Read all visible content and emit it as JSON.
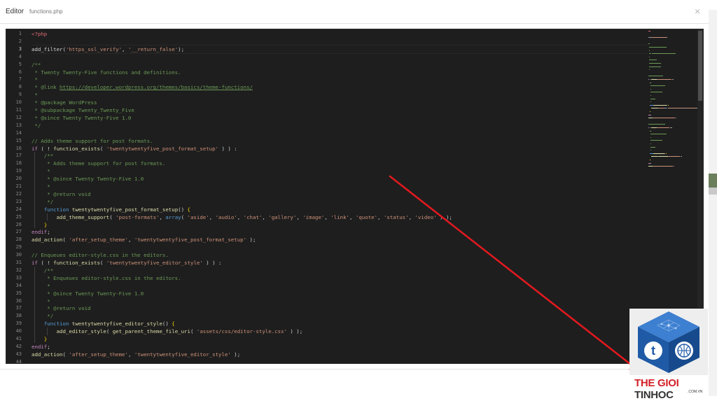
{
  "modal": {
    "title": "Editor",
    "subtitle": "functions.php",
    "close_symbol": "×"
  },
  "editor": {
    "active_line": 3,
    "lines": [
      [
        [
          "<?php",
          "php"
        ]
      ],
      [],
      [
        [
          "add_filter(",
          "plain"
        ],
        [
          "'https_ssl_verify'",
          "str"
        ],
        [
          ", ",
          "plain"
        ],
        [
          "'__return_false'",
          "str"
        ],
        [
          ");",
          "plain"
        ]
      ],
      [],
      [
        [
          "/**",
          "cmt"
        ]
      ],
      [
        [
          " * Twenty Twenty-Five functions and definitions.",
          "cmt"
        ]
      ],
      [
        [
          " *",
          "cmt"
        ]
      ],
      [
        [
          " * @link ",
          "cmt"
        ],
        [
          "https://developer.wordpress.org/themes/basics/theme-functions/",
          "link"
        ]
      ],
      [
        [
          " *",
          "cmt"
        ]
      ],
      [
        [
          " * @package WordPress",
          "cmt"
        ]
      ],
      [
        [
          " * @subpackage Twenty_Twenty_Five",
          "cmt"
        ]
      ],
      [
        [
          " * @since Twenty Twenty-Five 1.0",
          "cmt"
        ]
      ],
      [
        [
          " */",
          "cmt"
        ]
      ],
      [],
      [
        [
          "// Adds theme support for post formats.",
          "cmt"
        ]
      ],
      [
        [
          "if",
          "ctl"
        ],
        [
          " ( ! ",
          "plain"
        ],
        [
          "function_exists",
          "fn"
        ],
        [
          "( ",
          "plain"
        ],
        [
          "'twentytwentyfive_post_format_setup'",
          "str"
        ],
        [
          " ) ) :",
          "plain"
        ]
      ],
      [
        [
          "    /**",
          "cmt"
        ]
      ],
      [
        [
          "     * Adds theme support for post formats.",
          "cmt"
        ]
      ],
      [
        [
          "     *",
          "cmt"
        ]
      ],
      [
        [
          "     * @since Twenty Twenty-Five 1.0",
          "cmt"
        ]
      ],
      [
        [
          "     *",
          "cmt"
        ]
      ],
      [
        [
          "     * @return void",
          "cmt"
        ]
      ],
      [
        [
          "     */",
          "cmt"
        ]
      ],
      [
        [
          "    ",
          "plain"
        ],
        [
          "function",
          "kw"
        ],
        [
          " ",
          "plain"
        ],
        [
          "twentytwentyfive_post_format_setup",
          "fn"
        ],
        [
          "() ",
          "plain"
        ],
        [
          "{",
          "brace"
        ]
      ],
      [
        [
          "        ",
          "plain"
        ],
        [
          "add_theme_support",
          "fn"
        ],
        [
          "( ",
          "plain"
        ],
        [
          "'post-formats'",
          "str"
        ],
        [
          ", ",
          "plain"
        ],
        [
          "array",
          "kw"
        ],
        [
          "( ",
          "plain"
        ],
        [
          "'aside'",
          "str"
        ],
        [
          ", ",
          "plain"
        ],
        [
          "'audio'",
          "str"
        ],
        [
          ", ",
          "plain"
        ],
        [
          "'chat'",
          "str"
        ],
        [
          ", ",
          "plain"
        ],
        [
          "'gallery'",
          "str"
        ],
        [
          ", ",
          "plain"
        ],
        [
          "'image'",
          "str"
        ],
        [
          ", ",
          "plain"
        ],
        [
          "'link'",
          "str"
        ],
        [
          ", ",
          "plain"
        ],
        [
          "'quote'",
          "str"
        ],
        [
          ", ",
          "plain"
        ],
        [
          "'status'",
          "str"
        ],
        [
          ", ",
          "plain"
        ],
        [
          "'video'",
          "str"
        ],
        [
          " ) );",
          "plain"
        ]
      ],
      [
        [
          "    ",
          "plain"
        ],
        [
          "}",
          "brace"
        ]
      ],
      [
        [
          "endif",
          "ctl"
        ],
        [
          ";",
          "plain"
        ]
      ],
      [
        [
          "add_action",
          "fn"
        ],
        [
          "( ",
          "plain"
        ],
        [
          "'after_setup_theme'",
          "str"
        ],
        [
          ", ",
          "plain"
        ],
        [
          "'twentytwentyfive_post_format_setup'",
          "str"
        ],
        [
          " );",
          "plain"
        ]
      ],
      [],
      [
        [
          "// Enqueues editor-style.css in the editors.",
          "cmt"
        ]
      ],
      [
        [
          "if",
          "ctl"
        ],
        [
          " ( ! ",
          "plain"
        ],
        [
          "function_exists",
          "fn"
        ],
        [
          "( ",
          "plain"
        ],
        [
          "'twentytwentyfive_editor_style'",
          "str"
        ],
        [
          " ) ) :",
          "plain"
        ]
      ],
      [
        [
          "    /**",
          "cmt"
        ]
      ],
      [
        [
          "     * Enqueues editor-style.css in the editors.",
          "cmt"
        ]
      ],
      [
        [
          "     *",
          "cmt"
        ]
      ],
      [
        [
          "     * @since Twenty Twenty-Five 1.0",
          "cmt"
        ]
      ],
      [
        [
          "     *",
          "cmt"
        ]
      ],
      [
        [
          "     * @return void",
          "cmt"
        ]
      ],
      [
        [
          "     */",
          "cmt"
        ]
      ],
      [
        [
          "    ",
          "plain"
        ],
        [
          "function",
          "kw"
        ],
        [
          " ",
          "plain"
        ],
        [
          "twentytwentyfive_editor_style",
          "fn"
        ],
        [
          "() ",
          "plain"
        ],
        [
          "{",
          "brace"
        ]
      ],
      [
        [
          "        ",
          "plain"
        ],
        [
          "add_editor_style",
          "fn"
        ],
        [
          "( ",
          "plain"
        ],
        [
          "get_parent_theme_file_uri",
          "fn"
        ],
        [
          "( ",
          "plain"
        ],
        [
          "'assets/css/editor-style.css'",
          "str"
        ],
        [
          " ) );",
          "plain"
        ]
      ],
      [
        [
          "    ",
          "plain"
        ],
        [
          "}",
          "brace"
        ]
      ],
      [
        [
          "endif",
          "ctl"
        ],
        [
          ";",
          "plain"
        ]
      ],
      [
        [
          "add_action",
          "fn"
        ],
        [
          "( ",
          "plain"
        ],
        [
          "'after_setup_theme'",
          "str"
        ],
        [
          ", ",
          "plain"
        ],
        [
          "'twentytwentyfive_editor_style'",
          "str"
        ],
        [
          " );",
          "plain"
        ]
      ],
      []
    ]
  },
  "watermark": {
    "brand_red": "THE GIOI",
    "brand_dark": " TINHOC",
    "domain": ".COM.VN",
    "logo_letters": "t",
    "logo_icon": "globe-icon"
  },
  "colors": {
    "editor_bg": "#1e1e1e",
    "arrow": "#e3191f",
    "logo_blue": "#1f5aa6",
    "brand_red": "#d32027"
  }
}
